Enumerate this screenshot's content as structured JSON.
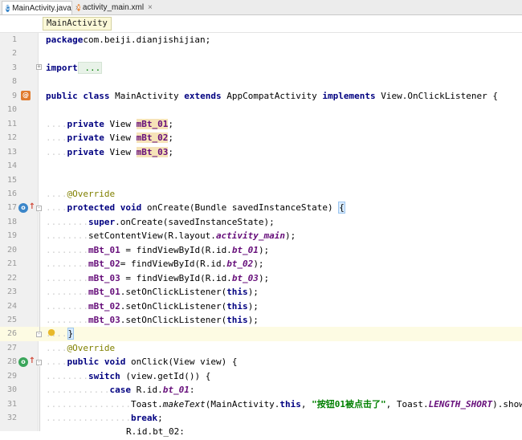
{
  "tabs": [
    {
      "label": "MainActivity.java",
      "icon": "c-class-icon",
      "active": true
    },
    {
      "label": "activity_main.xml",
      "icon": "xml-file-icon",
      "active": false
    }
  ],
  "close_glyph": "×",
  "breadcrumb": "MainActivity",
  "lines": [
    {
      "n": "1",
      "code": [
        [
          "kw",
          "package"
        ],
        [
          "",
          "com.beiji.dianjishijian;"
        ]
      ]
    },
    {
      "n": "2",
      "code": []
    },
    {
      "n": "3",
      "code": [
        [
          "kw",
          "import"
        ],
        [
          "",
          ""
        ],
        [
          "fold",
          "..."
        ]
      ]
    },
    {
      "n": "8",
      "code": []
    },
    {
      "n": "9",
      "code": [
        [
          "kw",
          "public"
        ],
        [
          "",
          " "
        ],
        [
          "kw",
          "class"
        ],
        [
          "",
          " MainActivity "
        ],
        [
          "kw",
          "extends"
        ],
        [
          "",
          " AppCompatActivity "
        ],
        [
          "kw",
          "implements"
        ],
        [
          "",
          " View.OnClickListener {"
        ]
      ]
    },
    {
      "n": "10",
      "code": []
    },
    {
      "n": "11",
      "code": [
        [
          "dots",
          "...."
        ],
        [
          "kw",
          "private"
        ],
        [
          "",
          " View "
        ],
        [
          "fldhl",
          "mBt_01"
        ],
        [
          "",
          ";"
        ]
      ]
    },
    {
      "n": "12",
      "code": [
        [
          "dots",
          "...."
        ],
        [
          "kw",
          "private"
        ],
        [
          "",
          " View "
        ],
        [
          "fldhl",
          "mBt_02"
        ],
        [
          "",
          ";"
        ]
      ]
    },
    {
      "n": "13",
      "code": [
        [
          "dots",
          "...."
        ],
        [
          "kw",
          "private"
        ],
        [
          "",
          " View "
        ],
        [
          "fldhl",
          "mBt_03"
        ],
        [
          "",
          ";"
        ]
      ]
    },
    {
      "n": "14",
      "code": []
    },
    {
      "n": "15",
      "code": []
    },
    {
      "n": "16",
      "code": [
        [
          "dots",
          "...."
        ],
        [
          "ann",
          "@Override"
        ]
      ]
    },
    {
      "n": "17",
      "code": [
        [
          "dots",
          "...."
        ],
        [
          "kw",
          "protected"
        ],
        [
          "",
          " "
        ],
        [
          "kw",
          "void"
        ],
        [
          "",
          " onCreate(Bundle savedInstanceState) "
        ],
        [
          "brace",
          "{"
        ]
      ]
    },
    {
      "n": "18",
      "code": [
        [
          "dots",
          "........"
        ],
        [
          "kw",
          "super"
        ],
        [
          "",
          ".onCreate(savedInstanceState);"
        ]
      ]
    },
    {
      "n": "19",
      "code": [
        [
          "dots",
          "........"
        ],
        [
          "",
          "setContentView(R.layout."
        ],
        [
          "sta",
          "activity_main"
        ],
        [
          "",
          ");"
        ]
      ]
    },
    {
      "n": "20",
      "code": [
        [
          "dots",
          "........"
        ],
        [
          "fld",
          "mBt_01"
        ],
        [
          "",
          " = findViewById(R.id."
        ],
        [
          "sta",
          "bt_01"
        ],
        [
          "",
          ");"
        ]
      ]
    },
    {
      "n": "21",
      "code": [
        [
          "dots",
          "........"
        ],
        [
          "fld",
          "mBt_02"
        ],
        [
          "",
          "= findViewById(R.id."
        ],
        [
          "sta",
          "bt_02"
        ],
        [
          "",
          ");"
        ]
      ]
    },
    {
      "n": "22",
      "code": [
        [
          "dots",
          "........"
        ],
        [
          "fld",
          "mBt_03"
        ],
        [
          "",
          " = findViewById(R.id."
        ],
        [
          "sta",
          "bt_03"
        ],
        [
          "",
          ");"
        ]
      ]
    },
    {
      "n": "23",
      "code": [
        [
          "dots",
          "........"
        ],
        [
          "fld",
          "mBt_01"
        ],
        [
          "",
          ".setOnClickListener("
        ],
        [
          "kw",
          "this"
        ],
        [
          "",
          ");"
        ]
      ]
    },
    {
      "n": "24",
      "code": [
        [
          "dots",
          "........"
        ],
        [
          "fld",
          "mBt_02"
        ],
        [
          "",
          ".setOnClickListener("
        ],
        [
          "kw",
          "this"
        ],
        [
          "",
          ");"
        ]
      ]
    },
    {
      "n": "25",
      "code": [
        [
          "dots",
          "........"
        ],
        [
          "fld",
          "mBt_03"
        ],
        [
          "",
          ".setOnClickListener("
        ],
        [
          "kw",
          "this"
        ],
        [
          "",
          ");"
        ]
      ]
    },
    {
      "n": "26",
      "code": [
        [
          "dots",
          "...."
        ],
        [
          "brace",
          "}"
        ]
      ],
      "current": true
    },
    {
      "n": "27",
      "code": [
        [
          "dots",
          "...."
        ],
        [
          "ann",
          "@Override"
        ]
      ]
    },
    {
      "n": "28",
      "code": [
        [
          "dots",
          "...."
        ],
        [
          "kw",
          "public"
        ],
        [
          "",
          " "
        ],
        [
          "kw",
          "void"
        ],
        [
          "",
          " onClick(View view) {"
        ]
      ]
    },
    {
      "n": "29",
      "code": [
        [
          "dots",
          "........"
        ],
        [
          "kw",
          "switch"
        ],
        [
          "",
          " (view.getId()) {"
        ]
      ]
    },
    {
      "n": "30",
      "code": [
        [
          "dots",
          "............"
        ],
        [
          "kw",
          "case"
        ],
        [
          "",
          " R.id."
        ],
        [
          "sta",
          "bt_01"
        ],
        [
          "",
          ":"
        ]
      ]
    },
    {
      "n": "31",
      "code": [
        [
          "dots",
          "................"
        ],
        [
          "",
          "Toast."
        ],
        [
          "stm",
          "makeText"
        ],
        [
          "",
          "(MainActivity."
        ],
        [
          "kw",
          "this"
        ],
        [
          "",
          ", "
        ],
        [
          "str",
          "\"按钮01被点击了\""
        ],
        [
          "",
          ", Toast."
        ],
        [
          "sta",
          "LENGTH_SHORT"
        ],
        [
          "",
          ").show();"
        ]
      ]
    },
    {
      "n": "32",
      "code": [
        [
          "dots",
          "................"
        ],
        [
          "kw",
          "break"
        ],
        [
          "",
          ";"
        ]
      ]
    }
  ],
  "partial_line": "R.id.bt_02:",
  "colors": {
    "keyword": "#000080",
    "field": "#660e7a",
    "annotation": "#808000",
    "string": "#008000",
    "current_line": "#fdfbe3"
  },
  "gutter_icons": {
    "line9": "class-icon",
    "line17": "override-icon",
    "line26": "lightbulb-icon",
    "line28": "override-icon"
  }
}
